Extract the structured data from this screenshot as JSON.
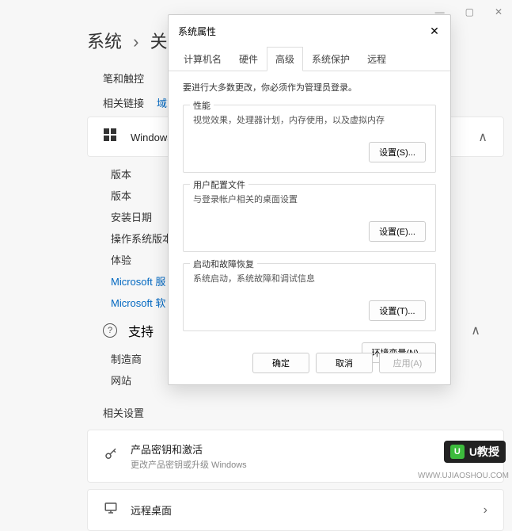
{
  "window_controls": {
    "min": "—",
    "max": "▢",
    "close": "✕"
  },
  "breadcrumb": {
    "a": "系统",
    "sep": "›",
    "b": "关"
  },
  "bg": {
    "pen_touch": "笔和触控",
    "related_links": "相关链接",
    "domain_link": "域或工",
    "win_spec": "Windows 规",
    "items": [
      "版本",
      "版本",
      "安装日期",
      "操作系统版本",
      "体验"
    ],
    "links": [
      "Microsoft 服",
      "Microsoft 软"
    ],
    "support": "支持",
    "maker": "制造商",
    "site": "网站",
    "related_settings": "相关设置",
    "product_key_title": "产品密钥和激活",
    "product_key_sub": "更改产品密钥或升级 Windows",
    "remote_desktop": "远程桌面"
  },
  "dialog": {
    "title": "系统属性",
    "tabs": [
      "计算机名",
      "硬件",
      "高级",
      "系统保护",
      "远程"
    ],
    "active_tab": 2,
    "admin_note": "要进行大多数更改，你必须作为管理员登录。",
    "perf": {
      "legend": "性能",
      "desc": "视觉效果，处理器计划，内存使用，以及虚拟内存",
      "btn": "设置(S)..."
    },
    "profile": {
      "legend": "用户配置文件",
      "desc": "与登录帐户相关的桌面设置",
      "btn": "设置(E)..."
    },
    "startup": {
      "legend": "启动和故障恢复",
      "desc": "系统启动，系统故障和调试信息",
      "btn": "设置(T)..."
    },
    "env_btn": "环境变量(N)...",
    "ok": "确定",
    "cancel": "取消",
    "apply": "应用(A)"
  },
  "brand": {
    "name": "U教授",
    "url": "WWW.UJIAOSHOU.COM"
  }
}
